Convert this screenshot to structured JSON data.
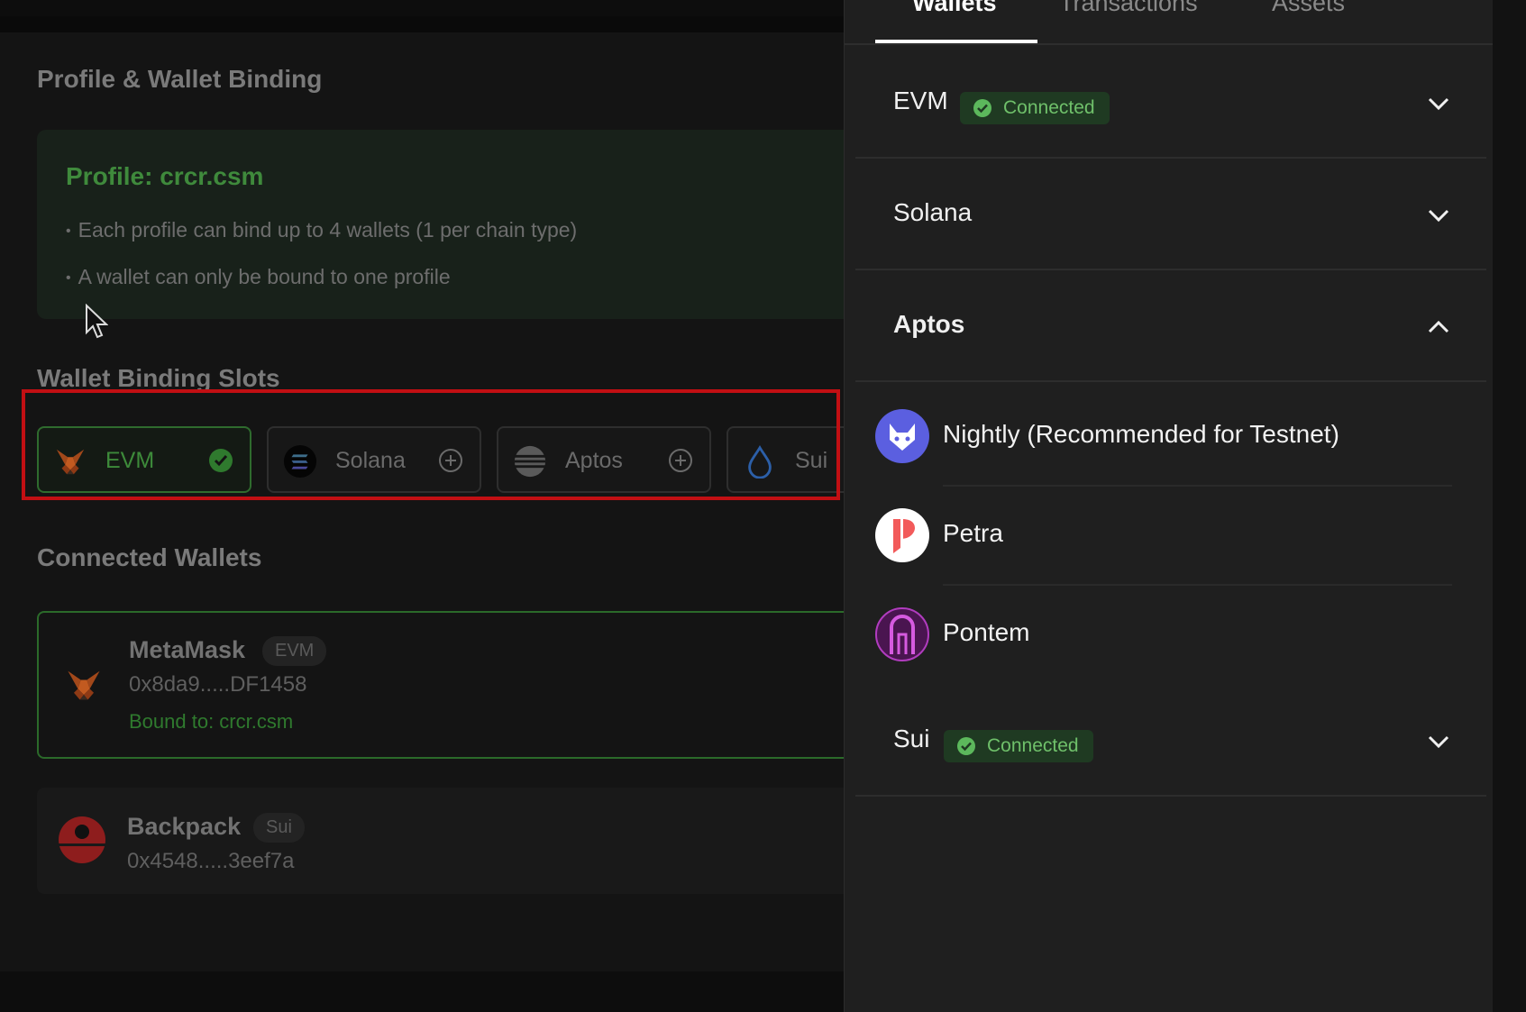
{
  "left": {
    "profile_section_title": "Profile & Wallet Binding",
    "profile_title": "Profile: crcr.csm",
    "rules": [
      "Each profile can bind up to 4 wallets (1 per chain type)",
      "A wallet can only be bound to one profile"
    ],
    "slots_title": "Wallet Binding Slots",
    "slots": [
      {
        "label": "EVM",
        "icon": "metamask-fox-icon",
        "state": "bound"
      },
      {
        "label": "Solana",
        "icon": "solana-icon",
        "state": "empty"
      },
      {
        "label": "Aptos",
        "icon": "aptos-icon",
        "state": "empty"
      },
      {
        "label": "Sui",
        "icon": "sui-droplet-icon",
        "state": "empty"
      }
    ],
    "connected_title": "Connected Wallets",
    "wallets": [
      {
        "name": "MetaMask",
        "tag": "EVM",
        "address": "0x8da9.....DF1458",
        "bound": "Bound to: crcr.csm"
      },
      {
        "name": "Backpack",
        "tag": "Sui",
        "address": "0x4548.....3eef7a"
      }
    ]
  },
  "panel": {
    "tabs": [
      "Wallets",
      "Transactions",
      "Assets"
    ],
    "active_tab": "Wallets",
    "chains": [
      {
        "name": "EVM",
        "badge": "Connected",
        "expanded": false
      },
      {
        "name": "Solana",
        "expanded": false
      },
      {
        "name": "Aptos",
        "expanded": true
      },
      {
        "name": "Sui",
        "badge": "Connected",
        "expanded": false
      }
    ],
    "aptos_wallets": [
      {
        "label": "Nightly (Recommended for Testnet)",
        "icon": "nightly-icon"
      },
      {
        "label": "Petra",
        "icon": "petra-icon"
      },
      {
        "label": "Pontem",
        "icon": "pontem-icon"
      }
    ]
  },
  "colors": {
    "accent_green": "#3f8a3c",
    "highlight_red": "#c20f13",
    "badge_green": "#6fc06a"
  }
}
